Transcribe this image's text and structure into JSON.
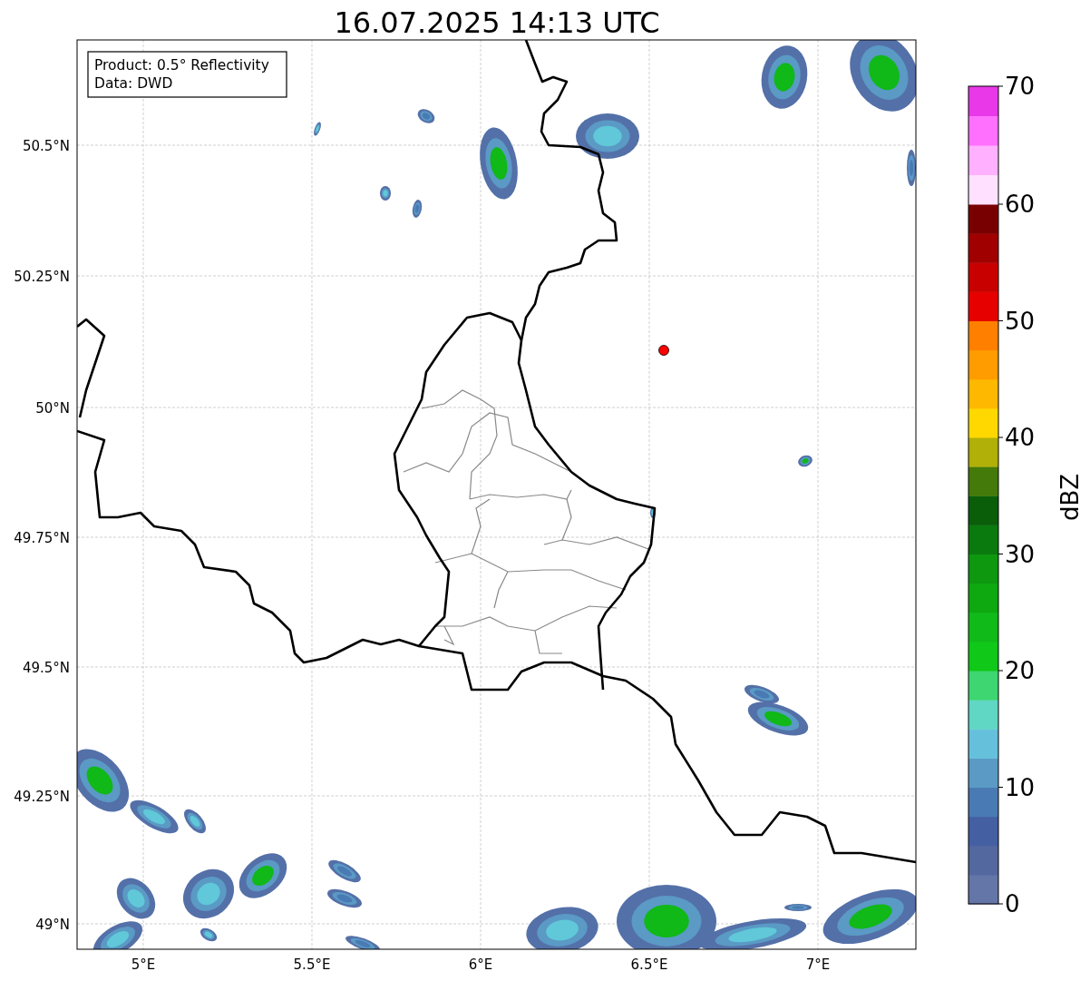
{
  "title": "16.07.2025 14:13 UTC",
  "info_box": {
    "lines": [
      "Product: 0.5° Reflectivity",
      "Data: DWD"
    ]
  },
  "map": {
    "lat_labels": [
      "50.5°N",
      "50.25°N",
      "50°N",
      "49.75°N",
      "49.5°N",
      "49.25°N",
      "49°N"
    ],
    "lon_labels": [
      "5°E",
      "5.5°E",
      "6°E",
      "6.5°E",
      "7°E"
    ]
  },
  "colorbar": {
    "label": "dBZ",
    "ticks": [
      "70",
      "60",
      "50",
      "40",
      "30",
      "20",
      "10",
      "0"
    ],
    "segments": [
      {
        "color": "#6475a8"
      },
      {
        "color": "#5468a0"
      },
      {
        "color": "#4460a3"
      },
      {
        "color": "#4a7ab3"
      },
      {
        "color": "#5a9ac5"
      },
      {
        "color": "#65c0dc"
      },
      {
        "color": "#60d6c4"
      },
      {
        "color": "#3dd670"
      },
      {
        "color": "#10c818"
      },
      {
        "color": "#10ba18"
      },
      {
        "color": "#0ea810"
      },
      {
        "color": "#0d9810"
      },
      {
        "color": "#0a7a0e"
      },
      {
        "color": "#0a5e0a"
      },
      {
        "color": "#447a0a"
      },
      {
        "color": "#b0b008"
      },
      {
        "color": "#ffd800"
      },
      {
        "color": "#ffb800"
      },
      {
        "color": "#ff9c00"
      },
      {
        "color": "#ff8000"
      },
      {
        "color": "#e60000"
      },
      {
        "color": "#c80000"
      },
      {
        "color": "#a00000"
      },
      {
        "color": "#780000"
      },
      {
        "color": "#ffe0ff"
      },
      {
        "color": "#ffb0ff"
      },
      {
        "color": "#ff70ff"
      },
      {
        "color": "#e838e8"
      }
    ]
  }
}
